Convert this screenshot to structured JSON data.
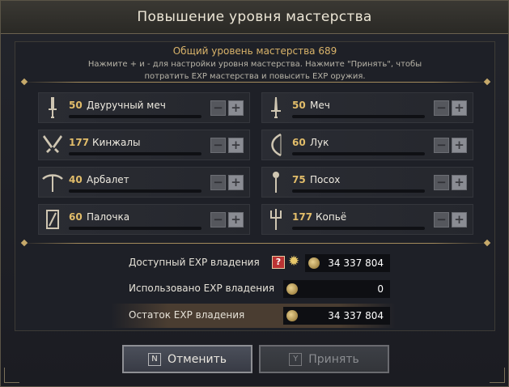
{
  "window": {
    "title": "Повышение уровня мастерства"
  },
  "header": {
    "total_mastery": "Общий уровень мастерства 689",
    "instruction_line1": "Нажмите + и - для настройки уровня мастерства. Нажмите \"Принять\", чтобы",
    "instruction_line2": "потратить EXP мастерства и повысить EXP оружия."
  },
  "weapons": [
    {
      "level": "50",
      "name": "Двуручный меч",
      "icon": "greatsword-icon"
    },
    {
      "level": "50",
      "name": "Меч",
      "icon": "sword-icon"
    },
    {
      "level": "177",
      "name": "Кинжалы",
      "icon": "daggers-icon"
    },
    {
      "level": "60",
      "name": "Лук",
      "icon": "bow-icon"
    },
    {
      "level": "40",
      "name": "Арбалет",
      "icon": "crossbow-icon"
    },
    {
      "level": "75",
      "name": "Посох",
      "icon": "staff-icon"
    },
    {
      "level": "60",
      "name": "Палочка",
      "icon": "wand-icon"
    },
    {
      "level": "177",
      "name": "Копьё",
      "icon": "spear-icon"
    }
  ],
  "controls": {
    "minus": "−",
    "plus": "+"
  },
  "exp": {
    "available_label": "Доступный EXP владения",
    "available_value": "34 337 804",
    "help": "?",
    "used_label": "Использовано EXP владения",
    "used_value": "0",
    "remaining_label": "Остаток EXP владения",
    "remaining_value": "34 337 804"
  },
  "buttons": {
    "cancel_key": "N",
    "cancel_label": "Отменить",
    "accept_key": "Y",
    "accept_label": "Принять"
  }
}
